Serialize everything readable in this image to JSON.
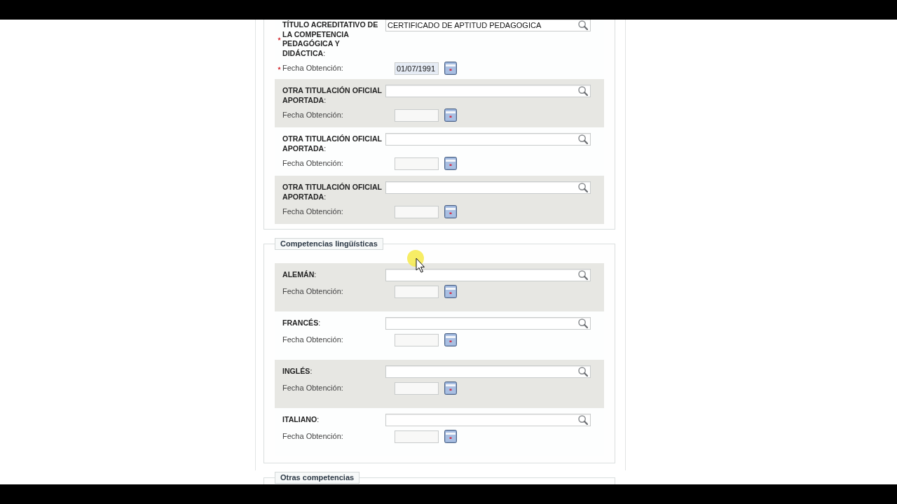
{
  "sections": [
    {
      "rows": [
        {
          "label": "**TÍTULO ACREDITATIVO DE LA COMPETENCIA PEDAGÓGICA Y DIDÁCTICA**:",
          "required": true,
          "shaded": false,
          "value": "CERTIFICADO DE APTITUD PEDAGOGICA",
          "date": {
            "label": "Fecha Obtención:",
            "required": true,
            "value": "01/07/1991"
          }
        },
        {
          "label": "**OTRA TITULACIÓN OFICIAL APORTADA**:",
          "required": false,
          "shaded": true,
          "date": {
            "label": "Fecha Obtención:",
            "required": false
          }
        },
        {
          "label": "**OTRA TITULACIÓN OFICIAL APORTADA**:",
          "required": false,
          "shaded": false,
          "date": {
            "label": "Fecha Obtención:",
            "required": false
          }
        },
        {
          "label": "**OTRA TITULACIÓN OFICIAL APORTADA**:",
          "required": false,
          "shaded": true,
          "date": {
            "label": "Fecha Obtención:",
            "required": false
          }
        }
      ]
    },
    {
      "legend": "Competencias lingüísticas",
      "rows": [
        {
          "label": "**ALEMÁN**:",
          "required": false,
          "shaded": true,
          "date": {
            "label": "Fecha Obtención:",
            "required": false
          }
        },
        {
          "label": "**FRANCÉS**:",
          "required": false,
          "shaded": false,
          "date": {
            "label": "Fecha Obtención:",
            "required": false
          }
        },
        {
          "label": "**INGLÉS**:",
          "required": false,
          "shaded": true,
          "date": {
            "label": "Fecha Obtención:",
            "required": false
          }
        },
        {
          "label": "**ITALIANO**:",
          "required": false,
          "shaded": false,
          "date": {
            "label": "Fecha Obtención:",
            "required": false
          }
        }
      ]
    },
    {
      "legend": "Otras competencias"
    }
  ]
}
